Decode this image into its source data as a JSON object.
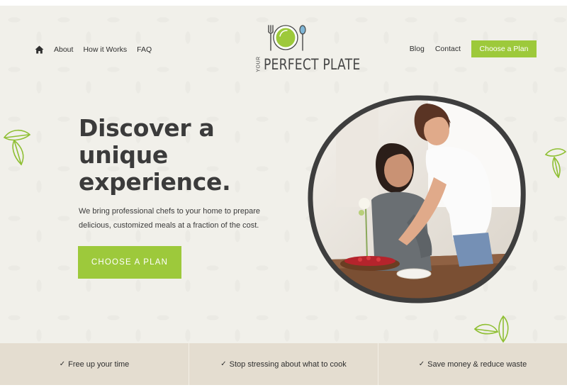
{
  "nav": {
    "left_links": [
      "About",
      "How it Works",
      "FAQ"
    ],
    "right_links": [
      "Blog",
      "Contact"
    ],
    "cta_label": "Choose a Plan",
    "home_icon": "home-icon"
  },
  "logo": {
    "prefix": "YOUR",
    "name": "PERFECT PLATE",
    "icon": "plate-fork-spoon-icon"
  },
  "hero": {
    "headline_lines": [
      "Discover a",
      "unique",
      "experience."
    ],
    "subtext_lines": [
      "We bring professional chefs to your home to prepare",
      "delicious, customized meals at a fraction of the cost."
    ],
    "cta_label": "CHOOSE A PLAN",
    "image": "mother-and-daughter-cooking-photo"
  },
  "features": [
    {
      "check": "✓",
      "label": "Free up your time"
    },
    {
      "check": "✓",
      "label": "Stop stressing about what to cook"
    },
    {
      "check": "✓",
      "label": "Save money & reduce waste"
    }
  ],
  "colors": {
    "accent": "#9dc93b",
    "background": "#f1f0eb",
    "feature_bar": "#e4ddd0",
    "text": "#3b3b3b"
  }
}
